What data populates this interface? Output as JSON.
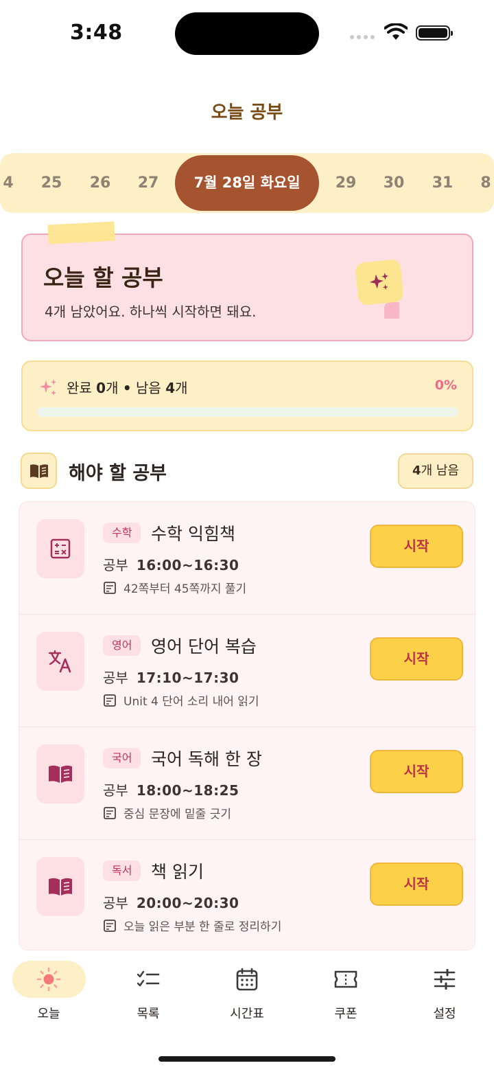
{
  "status_bar": {
    "time": "3:48"
  },
  "header": {
    "title": "오늘 공부"
  },
  "date_strip": {
    "dates": [
      "4",
      "25",
      "26",
      "27",
      "29",
      "30",
      "31",
      "8"
    ],
    "selected": "7월 28일 화요일"
  },
  "hero": {
    "title": "오늘 할 공부",
    "subtitle": "4개 남았어요. 하나씩 시작하면 돼요."
  },
  "progress": {
    "label_done": "완료",
    "done_count": "0",
    "label_unit": "개",
    "separator": "•",
    "label_remaining": "남음",
    "remaining_count": "4",
    "percent_text": "0%",
    "fraction": 0
  },
  "section": {
    "title": "해야 할 공부",
    "count_number": "4",
    "count_suffix": "개 남음"
  },
  "tasks": [
    {
      "subject": "수학",
      "title": "수학 익힘책",
      "time_label": "공부",
      "time": "16:00~16:30",
      "note": "42쪽부터 45쪽까지 풀기",
      "button": "시작",
      "icon": "calculator-icon"
    },
    {
      "subject": "영어",
      "title": "영어 단어 복습",
      "time_label": "공부",
      "time": "17:10~17:30",
      "note": "Unit 4 단어 소리 내어 읽기",
      "button": "시작",
      "icon": "translate-icon"
    },
    {
      "subject": "국어",
      "title": "국어 독해 한 장",
      "time_label": "공부",
      "time": "18:00~18:25",
      "note": "중심 문장에 밑줄 긋기",
      "button": "시작",
      "icon": "book-icon"
    },
    {
      "subject": "독서",
      "title": "책 읽기",
      "time_label": "공부",
      "time": "20:00~20:30",
      "note": "오늘 읽은 부분 한 줄로 정리하기",
      "button": "시작",
      "icon": "book-icon"
    }
  ],
  "nav": {
    "items": [
      {
        "label": "오늘",
        "icon": "sun-icon",
        "active": true
      },
      {
        "label": "목록",
        "icon": "checklist-icon",
        "active": false
      },
      {
        "label": "시간표",
        "icon": "calendar-icon",
        "active": false
      },
      {
        "label": "쿠폰",
        "icon": "ticket-icon",
        "active": false
      },
      {
        "label": "설정",
        "icon": "sliders-icon",
        "active": false
      }
    ]
  },
  "colors": {
    "accent_brown": "#a65430",
    "title_brown": "#7a4a14",
    "pink_bg": "#fde0e4",
    "yellow_bg": "#fdf0c6",
    "button_yellow": "#fdd147",
    "button_text": "#b8343f"
  }
}
